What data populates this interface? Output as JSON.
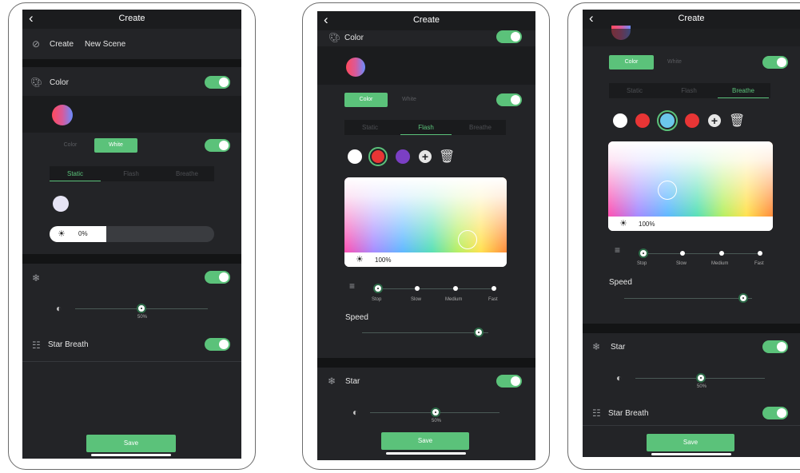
{
  "common": {
    "back": "‹",
    "title": "Create",
    "save": "Save"
  },
  "s1": {
    "create_label": "Create",
    "scene_name": "New Scene",
    "color_label": "Color",
    "mode_tabs": [
      "Color",
      "White"
    ],
    "anim_tabs": [
      "Static",
      "Flash",
      "Breathe"
    ],
    "brightness": "0%",
    "slider_value": "50%",
    "star_breath_label": "Star Breath"
  },
  "s2": {
    "color_label": "Color",
    "mode_tabs": [
      "Color",
      "White"
    ],
    "anim_tabs": [
      "Static",
      "Flash",
      "Breathe"
    ],
    "brightness": "100%",
    "speeds": [
      "Stop",
      "Slow",
      "Medium",
      "Fast"
    ],
    "speed_label": "Speed",
    "star_label": "Star",
    "slider_value": "50%"
  },
  "s3": {
    "mode_tabs": [
      "Color",
      "White"
    ],
    "anim_tabs": [
      "Static",
      "Flash",
      "Breathe"
    ],
    "brightness": "100%",
    "speeds": [
      "Stop",
      "Slow",
      "Medium",
      "Fast"
    ],
    "speed_label": "Speed",
    "star_label": "Star",
    "slider_value": "50%",
    "star_breath_label": "Star Breath"
  },
  "colors": {
    "accent": "#5bc27a",
    "bg": "#232427",
    "header": "#1b1c1e"
  }
}
